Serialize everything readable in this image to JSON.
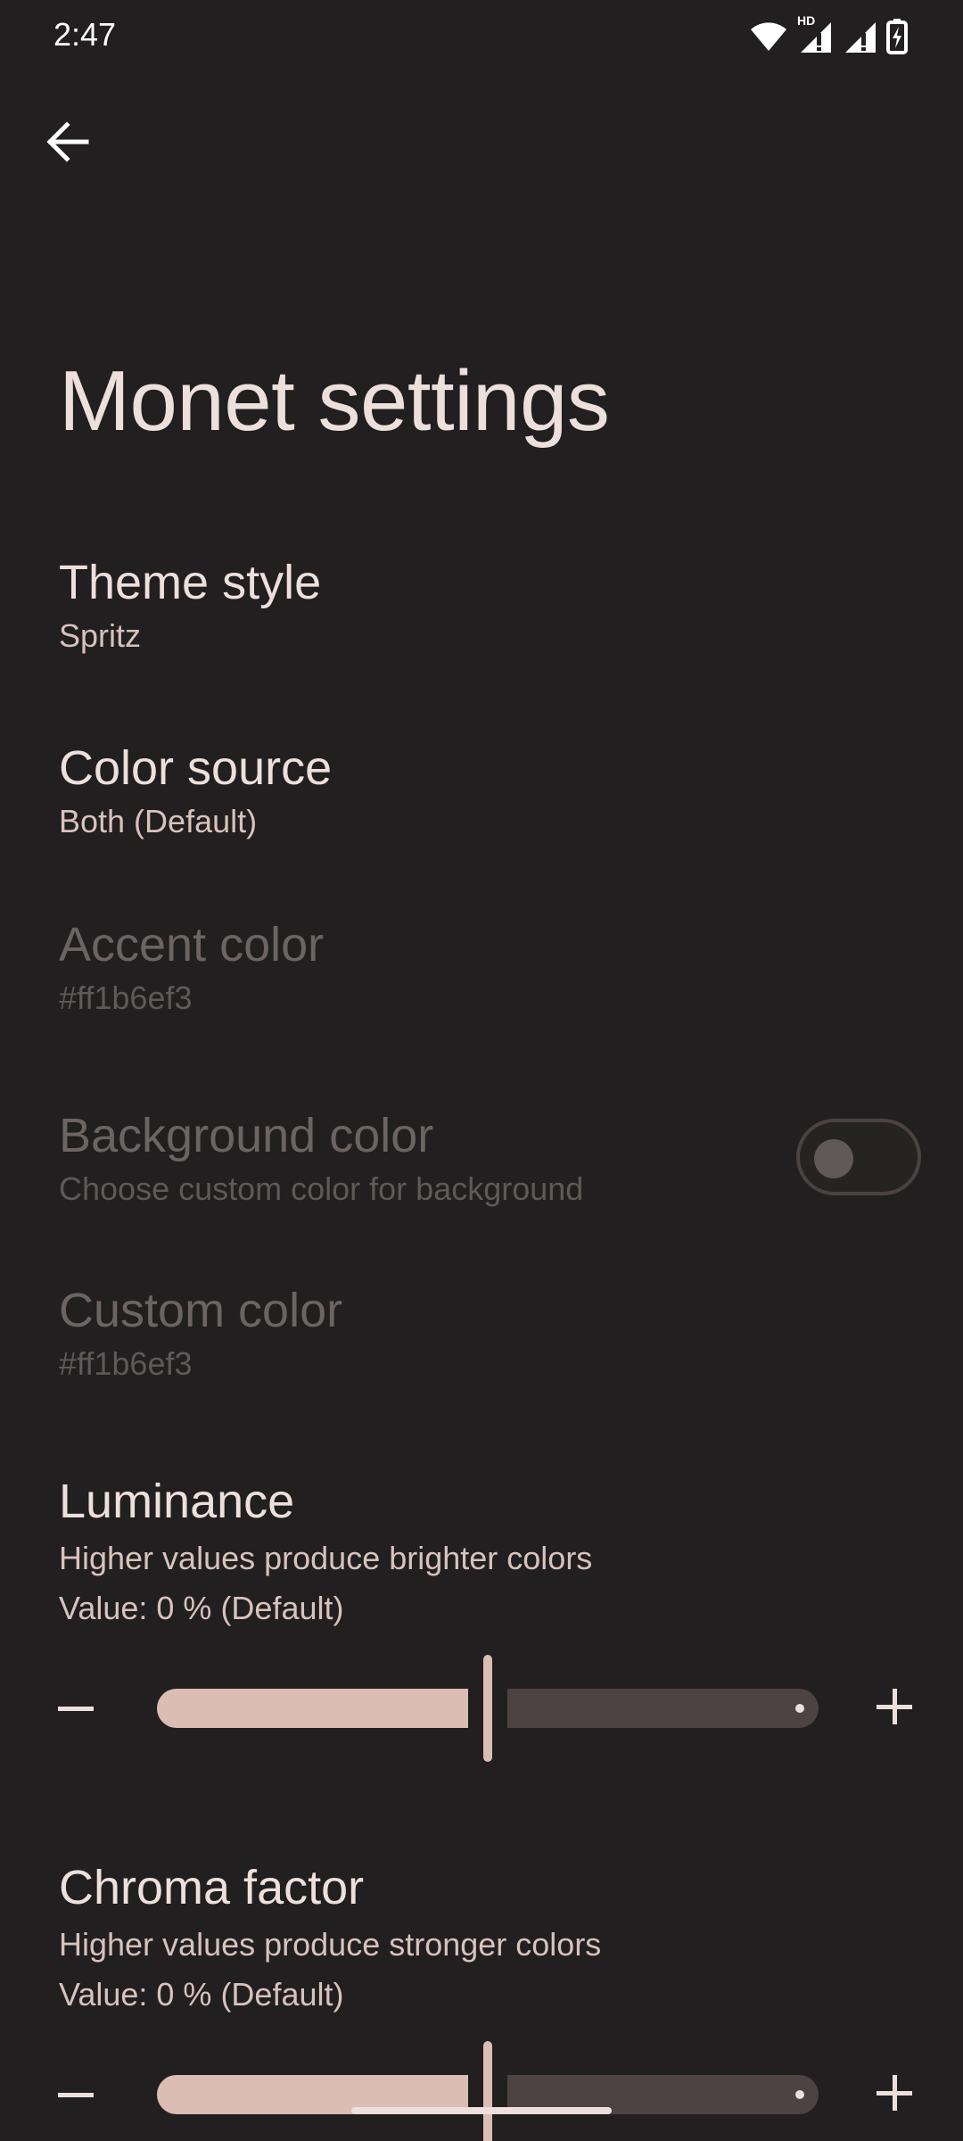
{
  "status_bar": {
    "time": "2:47",
    "icons": [
      "wifi-icon",
      "signal-hd-icon",
      "signal-icon",
      "battery-charging-icon"
    ],
    "hd_label": "HD"
  },
  "header": {
    "back_icon": "arrow-left-icon",
    "title": "Monet settings"
  },
  "preferences": [
    {
      "key": "theme_style",
      "title": "Theme style",
      "summary": "Spritz",
      "enabled": true
    },
    {
      "key": "color_source",
      "title": "Color source",
      "summary": "Both (Default)",
      "enabled": true
    },
    {
      "key": "accent_color",
      "title": "Accent color",
      "summary": "#ff1b6ef3",
      "enabled": false
    },
    {
      "key": "background_color",
      "title": "Background color",
      "summary": "Choose custom color for background",
      "enabled": false,
      "switch_on": false
    },
    {
      "key": "custom_color",
      "title": "Custom color",
      "summary": "#ff1b6ef3",
      "enabled": false
    }
  ],
  "sliders": [
    {
      "key": "luminance",
      "title": "Luminance",
      "summary": "Higher values produce brighter colors",
      "value_text": "Value: 0 % (Default)",
      "value_fraction": 0.5,
      "minus_icon": "minus-icon",
      "plus_icon": "plus-icon"
    },
    {
      "key": "chroma_factor",
      "title": "Chroma factor",
      "summary": "Higher values produce stronger colors",
      "value_text": "Value: 0 % (Default)",
      "value_fraction": 0.5,
      "minus_icon": "minus-icon",
      "plus_icon": "plus-icon"
    }
  ],
  "colors": {
    "background": "#211f1f",
    "primary_text": "#ede0dc",
    "secondary_text": "#d8c2bd",
    "disabled_text": "#6b6462",
    "slider_active": "#dbbdb3",
    "slider_inactive": "#4d4342"
  }
}
